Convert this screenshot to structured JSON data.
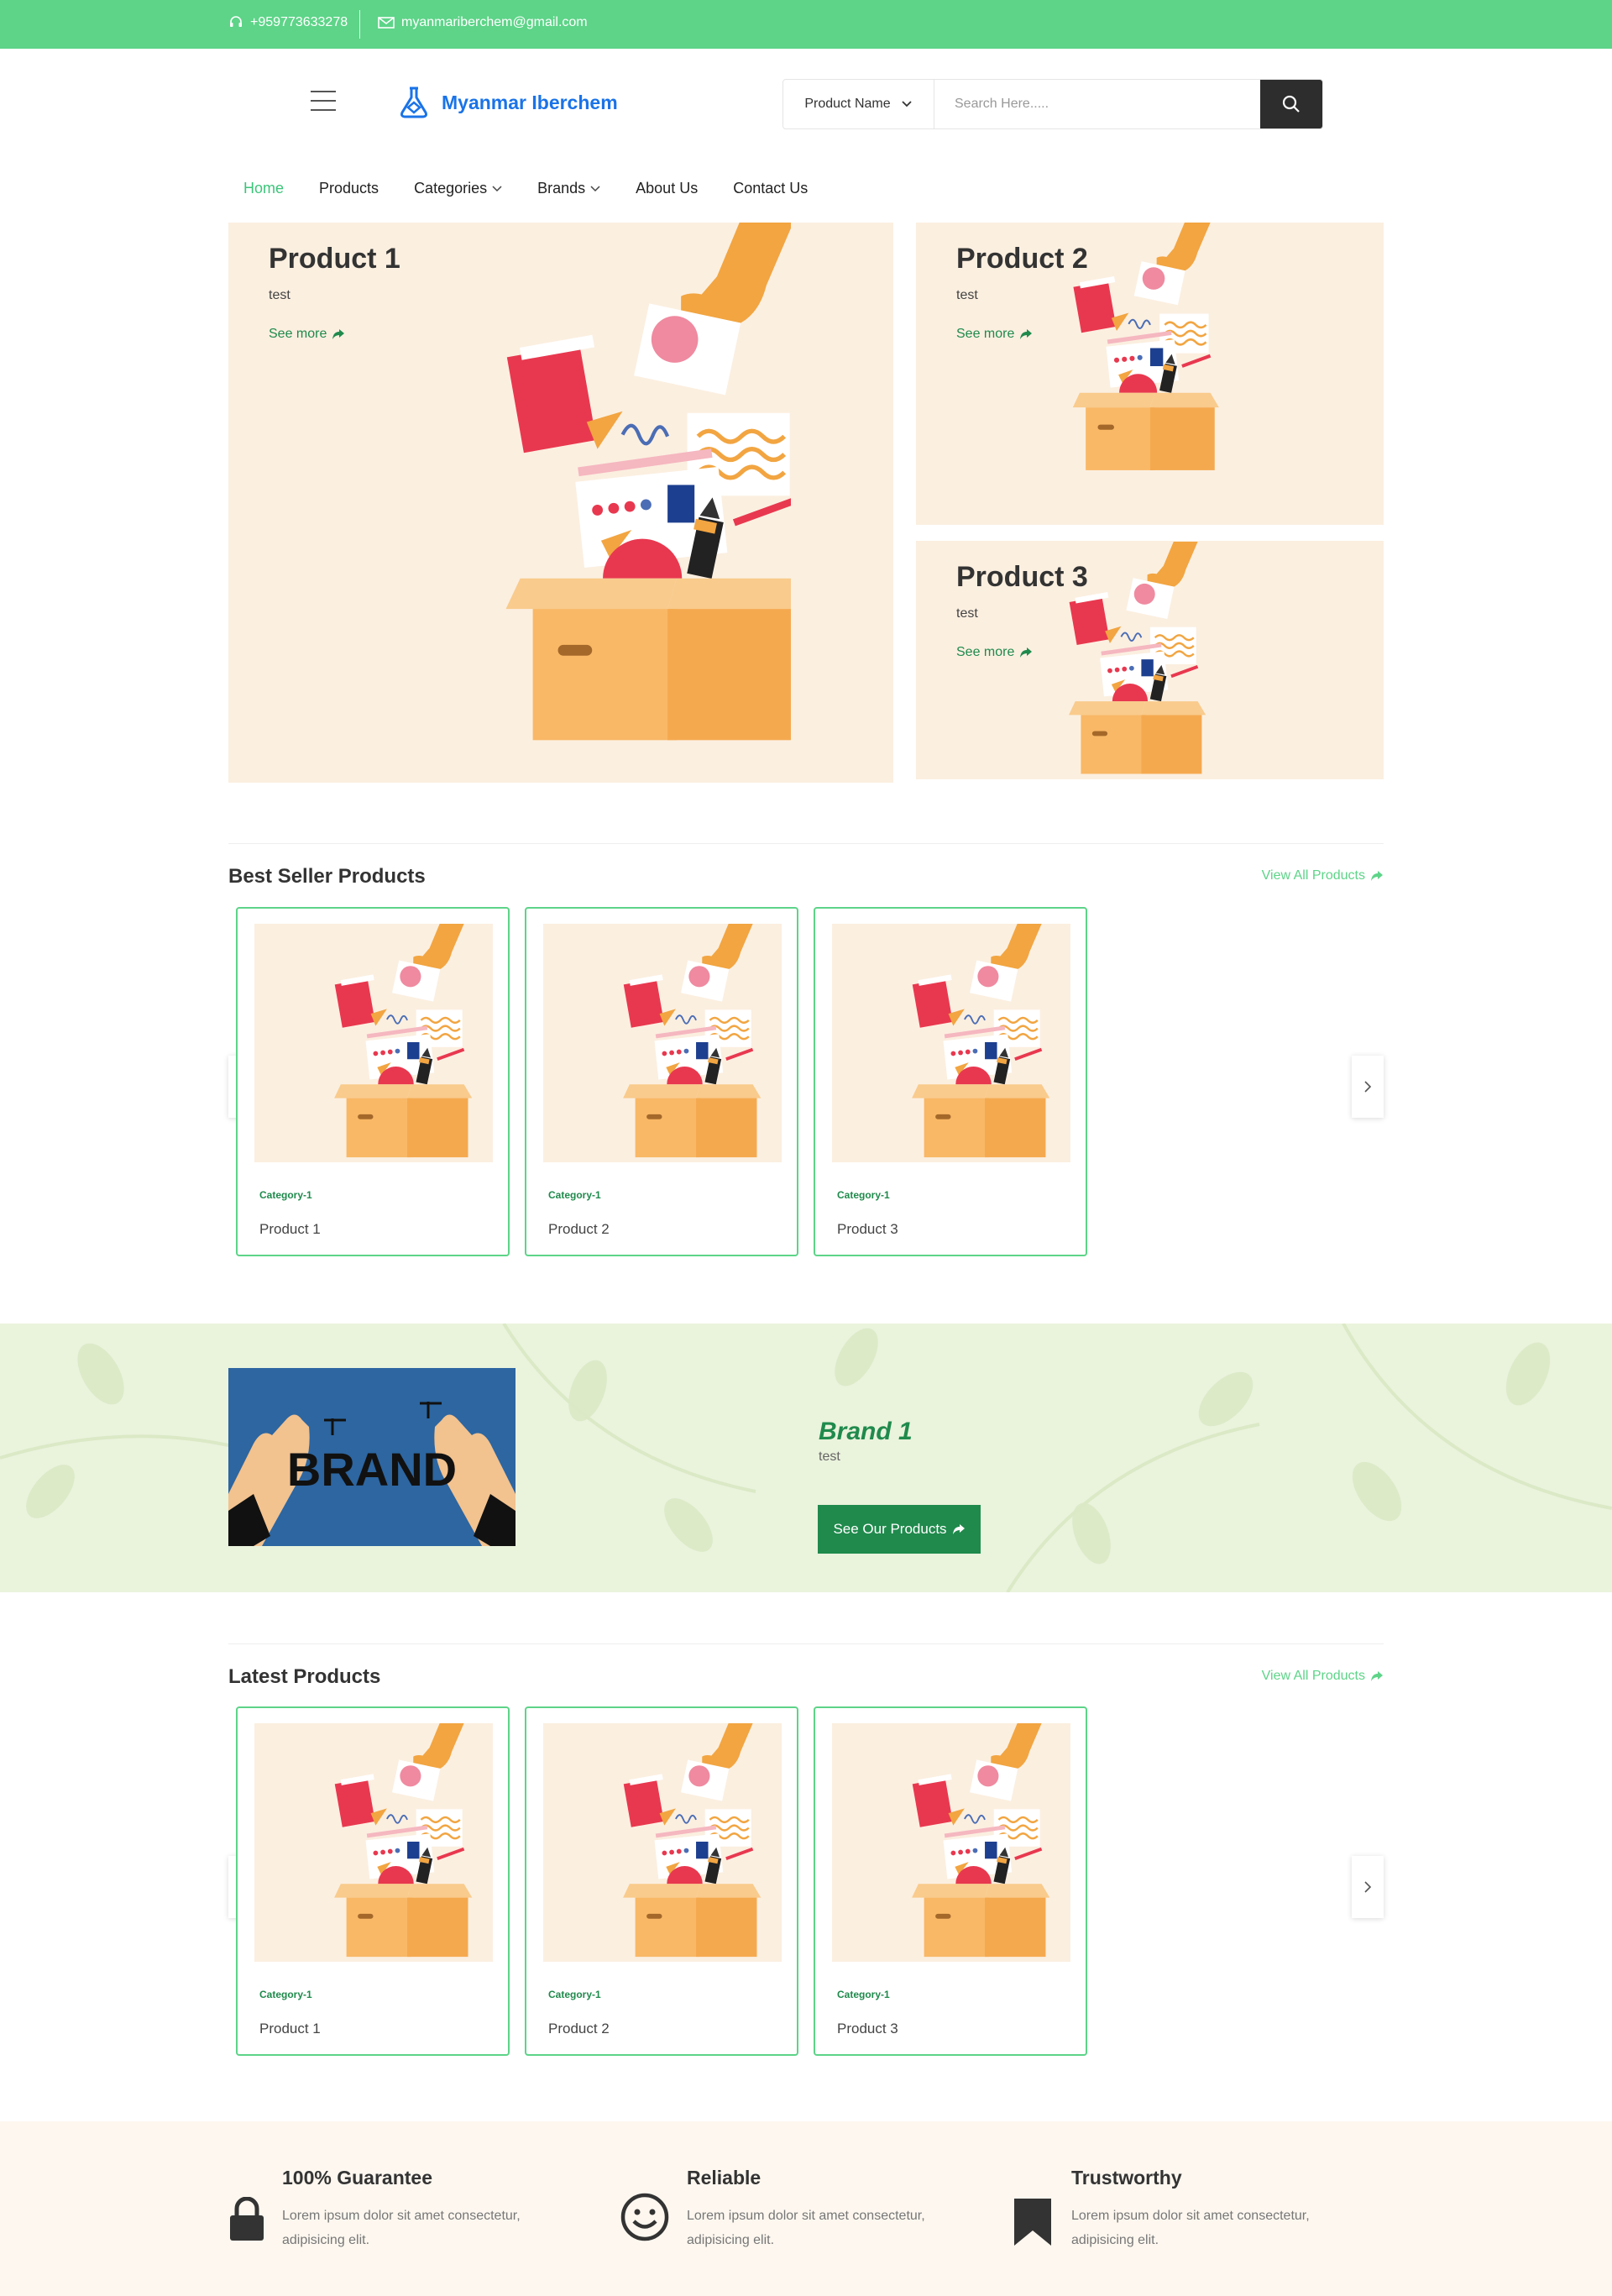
{
  "topbar": {
    "phone": "+959773633278",
    "email": "myanmariberchem@gmail.com"
  },
  "header": {
    "brand_name": "Myanmar Iberchem",
    "search_select": "Product Name",
    "search_placeholder": "Search Here....."
  },
  "nav": {
    "items": [
      {
        "label": "Home"
      },
      {
        "label": "Products"
      },
      {
        "label": "Categories"
      },
      {
        "label": "Brands"
      },
      {
        "label": "About Us"
      },
      {
        "label": "Contact Us"
      }
    ]
  },
  "hero": {
    "slides": [
      {
        "title": "Product 1",
        "desc": "test",
        "link": "See more"
      },
      {
        "title": "Product 2",
        "desc": "test",
        "link": "See more"
      },
      {
        "title": "Product 3",
        "desc": "test",
        "link": "See more"
      }
    ]
  },
  "best_seller": {
    "title": "Best Seller Products",
    "view_all": "View All Products",
    "products": [
      {
        "category": "Category-1",
        "name": "Product 1"
      },
      {
        "category": "Category-1",
        "name": "Product 2"
      },
      {
        "category": "Category-1",
        "name": "Product 3"
      }
    ]
  },
  "brand": {
    "image_text": "BRAND",
    "name": "Brand 1",
    "desc": "test",
    "button": "See Our Products"
  },
  "latest": {
    "title": "Latest Products",
    "view_all": "View All Products",
    "products": [
      {
        "category": "Category-1",
        "name": "Product 1"
      },
      {
        "category": "Category-1",
        "name": "Product 2"
      },
      {
        "category": "Category-1",
        "name": "Product 3"
      }
    ]
  },
  "features": [
    {
      "title": "100% Guarantee",
      "desc": "Lorem ipsum dolor sit amet consectetur, adipisicing elit.",
      "icon": "lock-icon"
    },
    {
      "title": "Reliable",
      "desc": "Lorem ipsum dolor sit amet consectetur, adipisicing elit.",
      "icon": "smiley-icon"
    },
    {
      "title": "Trustworthy",
      "desc": "Lorem ipsum dolor sit amet consectetur, adipisicing elit.",
      "icon": "bookmark-icon"
    }
  ],
  "colors": {
    "topbar": "#5dd488",
    "accent_green": "#1f8a4c",
    "brand_blue": "#1a73e8",
    "hero_bg": "#fbefe0",
    "brand_band": "#eaf3dc"
  }
}
